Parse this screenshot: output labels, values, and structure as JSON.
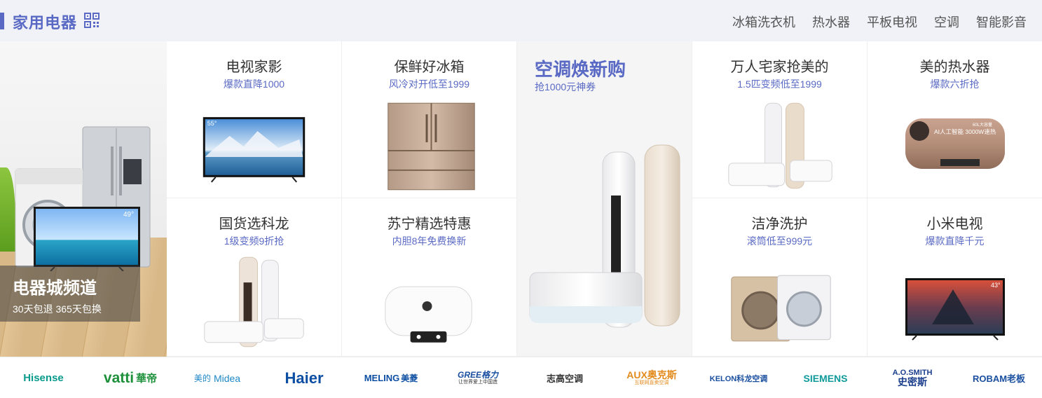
{
  "header": {
    "title": "家用电器",
    "nav": [
      "冰箱洗衣机",
      "热水器",
      "平板电视",
      "空调",
      "智能影音"
    ]
  },
  "banner": {
    "title": "电器城频道",
    "subtitle": "30天包退 365天包换",
    "tv_size_label": "49°"
  },
  "cells": [
    {
      "title": "电视家影",
      "subtitle": "爆款直降1000",
      "icon": "tv-icon",
      "badge": "55°"
    },
    {
      "title": "保鲜好冰箱",
      "subtitle": "风冷对开低至1999",
      "icon": "fridge-icon"
    },
    {
      "title": "万人宅家抢美的",
      "subtitle": "1.5匹变频低至1999",
      "icon": "air-conditioner-icon"
    },
    {
      "title": "美的热水器",
      "subtitle": "爆款六折抢",
      "icon": "water-heater-icon",
      "badge": "AI人工智能 3000W速热",
      "badge2": "60L大容量"
    },
    {
      "title": "国货选科龙",
      "subtitle": "1级变频9折抢",
      "icon": "air-conditioner-icon"
    },
    {
      "title": "苏宁精选特惠",
      "subtitle": "内胆8年免费换新",
      "icon": "water-heater-icon"
    },
    {
      "title": "洁净洗护",
      "subtitle": "滚筒低至999元",
      "icon": "washing-machine-icon"
    },
    {
      "title": "小米电视",
      "subtitle": "爆款直降千元",
      "icon": "tv-icon",
      "badge": "43°"
    }
  ],
  "featured": {
    "title": "空调焕新购",
    "subtitle": "抢1000元神券",
    "icon": "air-conditioner-icon"
  },
  "brands": [
    {
      "name": "Hisense",
      "color": "#0a9b8c"
    },
    {
      "name": "vatti",
      "extra": "華帝",
      "color": "#1c8f3a"
    },
    {
      "name": "美的",
      "extra": "Midea",
      "color": "#1e88c7"
    },
    {
      "name": "Haier",
      "color": "#0c4ea2"
    },
    {
      "name": "MELING",
      "extra": "美菱",
      "color": "#0c4ea2"
    },
    {
      "name": "GREE格力",
      "extra": "让世界爱上中国造",
      "color": "#1a4fa0"
    },
    {
      "name": "志高空调",
      "color": "#333333"
    },
    {
      "name": "AUX奥克斯",
      "extra": "互联网直卖空调",
      "color": "#e28a1c"
    },
    {
      "name": "KELON科龙空调",
      "color": "#1a4fa0"
    },
    {
      "name": "SIEMENS",
      "color": "#0e9a9a"
    },
    {
      "name": "A.O.SMITH",
      "extra": "史密斯",
      "color": "#1a3e8c"
    },
    {
      "name": "ROBAM老板",
      "color": "#1a4fa0"
    }
  ],
  "colors": {
    "accent": "#5a6ac4",
    "header_bg": "#f1f2f8",
    "featured_bg": "#f5f5f5"
  }
}
